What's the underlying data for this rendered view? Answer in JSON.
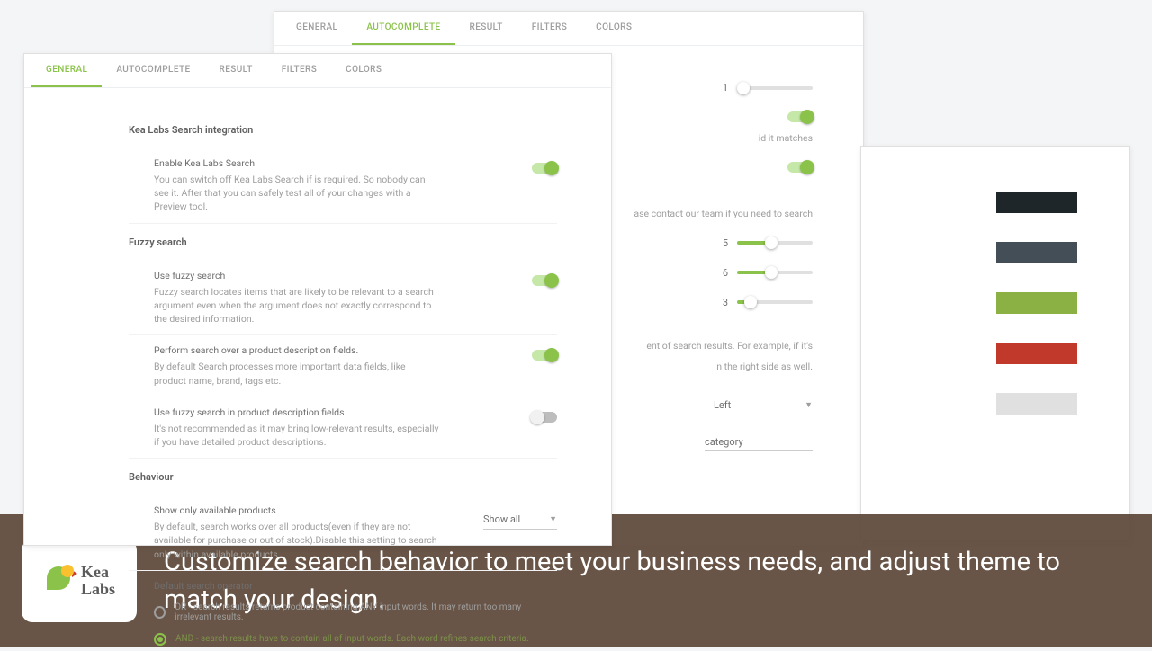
{
  "tabs": [
    "GENERAL",
    "AUTOCOMPLETE",
    "RESULT",
    "FILTERS",
    "COLORS"
  ],
  "back": {
    "activeTab": "AUTOCOMPLETE",
    "sliders": [
      {
        "label": "1",
        "pct": 8
      },
      {
        "label": "5",
        "pct": 45
      },
      {
        "label": "6",
        "pct": 45
      },
      {
        "label": "3",
        "pct": 18
      }
    ],
    "note1": "id it matches",
    "note2": "ase contact our team if you need to search",
    "note3": "ent of search results. For example, if it's",
    "note4": "n the right side as well.",
    "selectValue": "Left",
    "inputValue": "category"
  },
  "front": {
    "activeTab": "GENERAL",
    "sections": {
      "integration": {
        "title": "Kea Labs Search integration",
        "enable": {
          "title": "Enable Kea Labs Search",
          "desc": "You can switch off Kea Labs Search if is required. So nobody can see it. After that you can safely test all of your changes with a Preview tool."
        }
      },
      "fuzzy": {
        "title": "Fuzzy search",
        "use": {
          "title": "Use fuzzy search",
          "desc": "Fuzzy search locates items that are likely to be relevant to a search argument even when the argument does not exactly correspond to the desired information."
        },
        "desc_fields": {
          "title": "Perform search over a product description fields.",
          "desc": "By default Search processes more important data fields, like product name, brand, tags etc."
        },
        "fuzzy_desc": {
          "title": "Use fuzzy search in product description fields",
          "desc": "It's not recommended as it may bring low-relevant results, especially if you have detailed product descriptions."
        }
      },
      "behaviour": {
        "title": "Behaviour",
        "available": {
          "title": "Show only available products",
          "desc": "By default, search works over all products(even if they are not available for purchase or out of stock).Disable this setting to search only within available products.",
          "value": "Show all"
        },
        "operator": {
          "title": "Default search operator",
          "or": "OR - search results returns product containing ANY input words. It may return too many irrelevant results.",
          "and": "AND - search results have to contain all of input words. Each word refines search criteria."
        }
      }
    }
  },
  "colors": [
    "#1f262a",
    "#444e57",
    "#8bb044",
    "#c0392b",
    "#e0e0e0"
  ],
  "footer": {
    "brand1": "Kea",
    "brand2": "Labs",
    "tagline": "Customize search behavior to meet your business needs, and adjust theme to match your design."
  }
}
